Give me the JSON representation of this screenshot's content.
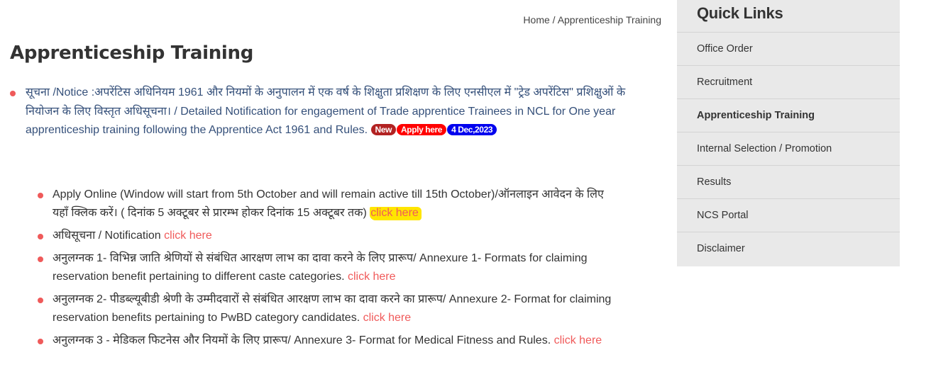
{
  "breadcrumb": {
    "home": "Home",
    "separator": " / ",
    "current": "Apprenticeship Training"
  },
  "page_title": "Apprenticeship Training",
  "notice": {
    "text": "सूचना /Notice :अपरेंटिस अधिनियम 1961 और नियमों के अनुपालन में एक वर्ष के शिक्षुता प्रशिक्षण के लिए एनसीएल में \"ट्रेड अपरेंटिस\" प्रशिक्षुओं के नियोजन के लिए विस्तृत अधिसूचना। / Detailed Notification for engagement of Trade apprentice Trainees in NCL for One year apprenticeship training following the Apprentice Act 1961 and Rules. ",
    "badges": {
      "new": "New",
      "apply": "Apply here",
      "date": "4 Dec,2023"
    }
  },
  "items": [
    {
      "text": "Apply Online (Window will start from 5th October and will remain active till 15th October)/ऑनलाइन आवेदन के लिए यहाँ क्लिक करें। ( दिनांक 5 अक्टूबर से प्रारम्भ होकर दिनांक 15 अक्टूबर तक) ",
      "link": "click here"
    },
    {
      "text": "अधिसूचना / Notification ",
      "link": "click here"
    },
    {
      "text": "अनुलग्नक 1- विभिन्न जाति श्रेणियों से संबंधित आरक्षण लाभ का दावा करने के लिए प्रारूप/ Annexure 1- Formats for claiming reservation benefit pertaining to different caste categories. ",
      "link": "click here"
    },
    {
      "text": "अनुलग्नक 2- पीडब्ल्यूबीडी श्रेणी के उम्मीदवारों से संबंधित आरक्षण लाभ का दावा करने का प्रारूप/ Annexure 2- Format for claiming reservation benefits pertaining to PwBD category candidates. ",
      "link": "click here"
    },
    {
      "text": "अनुलग्नक 3 - मेडिकल फिटनेस और नियमों के लिए प्रारूप/ Annexure 3- Format for Medical Fitness and Rules. ",
      "link": "click here"
    }
  ],
  "sidebar": {
    "title": "Quick Links",
    "items": [
      {
        "label": "Office Order"
      },
      {
        "label": "Recruitment"
      },
      {
        "label": "Apprenticeship Training"
      },
      {
        "label": "Internal Selection / Promotion"
      },
      {
        "label": "Results"
      },
      {
        "label": "NCS Portal"
      },
      {
        "label": "Disclaimer"
      }
    ],
    "active_index": 2
  },
  "colors": {
    "bullet": "#ef5a5a",
    "link": "#f05a5a",
    "notice_text": "#35507a",
    "badge_new": "#b22222",
    "badge_apply": "#ff0000",
    "badge_date": "#0000ee",
    "highlight": "#ffe500",
    "sidebar_bg": "#e9e9e9"
  }
}
